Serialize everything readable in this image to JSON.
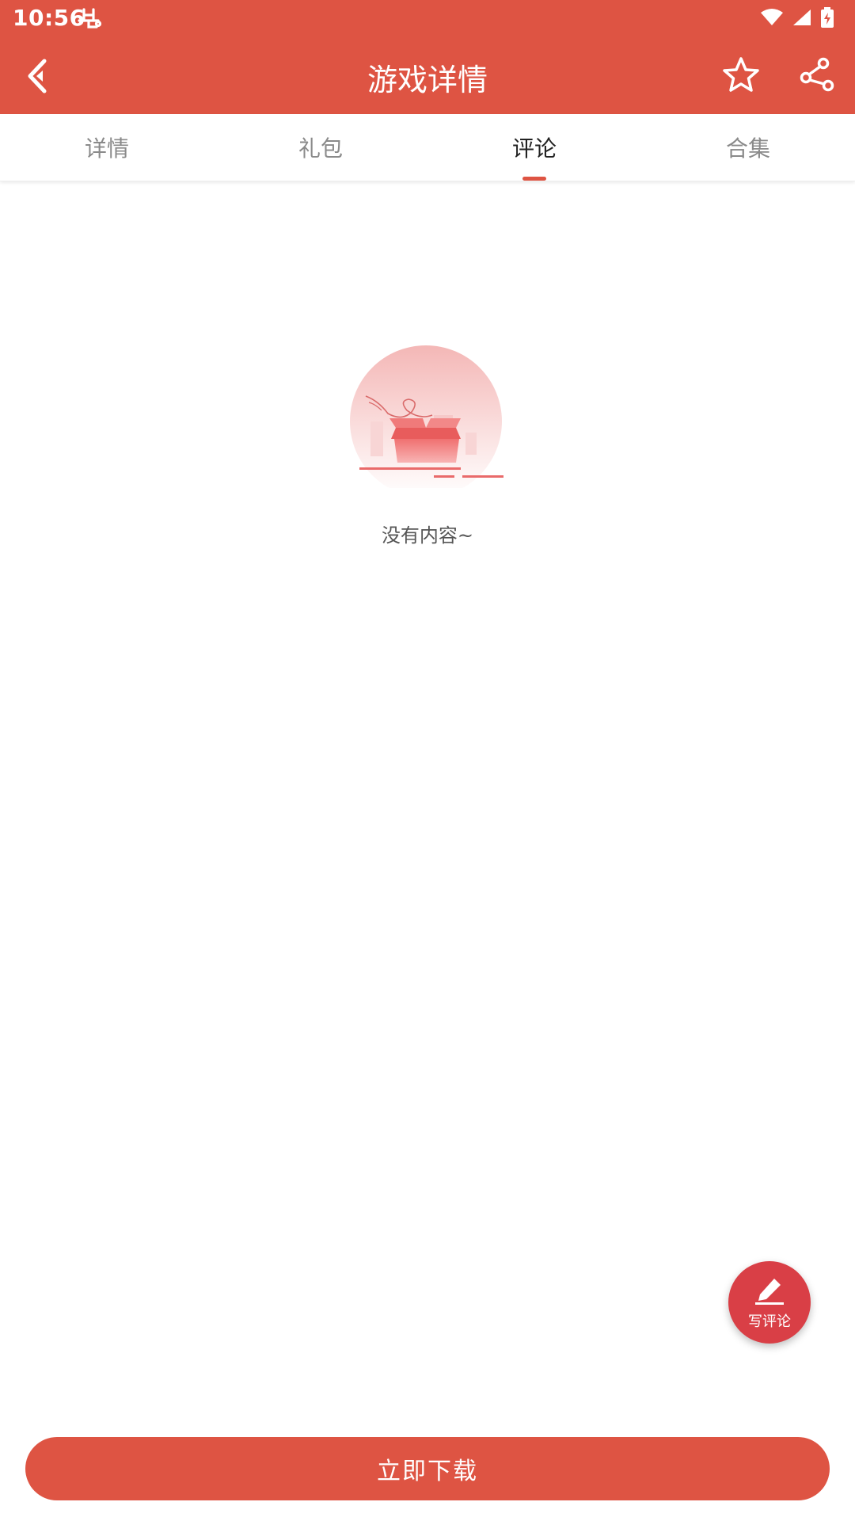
{
  "status_bar": {
    "time": "10:56",
    "app_icon": "bug-icon"
  },
  "toolbar": {
    "title": "游戏详情",
    "back_icon": "back-chevron-icon",
    "favorite_icon": "star-icon",
    "share_icon": "share-icon"
  },
  "tabs": [
    {
      "label": "详情",
      "active": false
    },
    {
      "label": "礼包",
      "active": false
    },
    {
      "label": "评论",
      "active": true
    },
    {
      "label": "合集",
      "active": false
    }
  ],
  "empty_state": {
    "message": "没有内容~",
    "illustration": "empty-box-icon"
  },
  "fab": {
    "label": "写评论",
    "icon": "pen-icon"
  },
  "download_button": {
    "label": "立即下载"
  },
  "colors": {
    "primary": "#DE5443",
    "fab": "#D93F46",
    "tab_active_text": "#222222",
    "tab_inactive_text": "#8a8a8a"
  }
}
